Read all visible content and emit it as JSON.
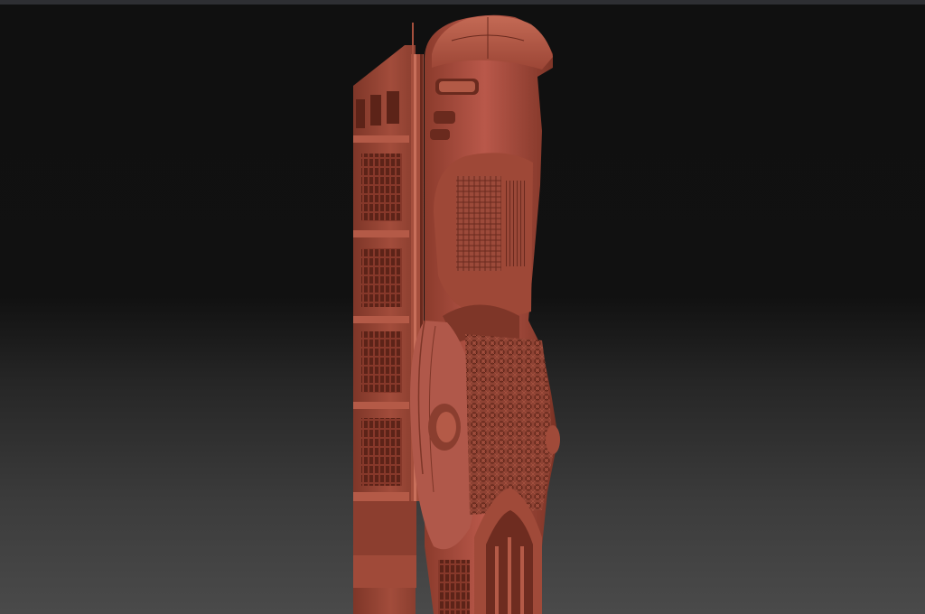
{
  "app": {
    "kind": "3d-sculpting-viewport"
  },
  "viewport": {
    "background_top_color": "#101010",
    "background_bottom_color": "#4a4a4a",
    "top_bar_color": "#2e2f33"
  },
  "model": {
    "subject": "ornate-building-tower-sculpt",
    "material_color": "#9c4a3a",
    "material_highlight": "#c0604a",
    "material_shadow": "#5a2218"
  }
}
